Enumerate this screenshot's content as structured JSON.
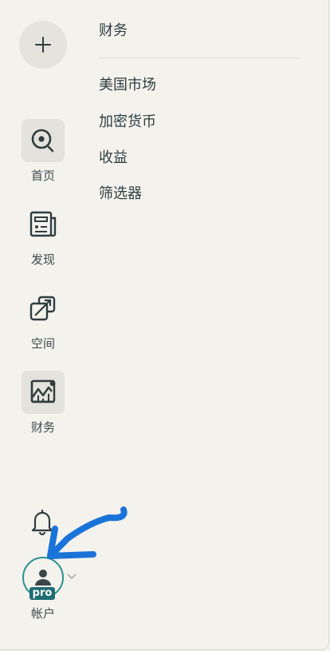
{
  "sidebar": {
    "items": [
      {
        "label": "首页",
        "icon": "search-circle-icon",
        "active": true
      },
      {
        "label": "发现",
        "icon": "newspaper-icon",
        "active": false
      },
      {
        "label": "空间",
        "icon": "spaces-icon",
        "active": false
      },
      {
        "label": "财务",
        "icon": "chart-line-icon",
        "active": true
      }
    ],
    "account": {
      "label": "帐户",
      "badge": "pro"
    }
  },
  "menu": {
    "title": "财务",
    "links": [
      "美国市场",
      "加密货币",
      "收益",
      "筛选器"
    ]
  },
  "colors": {
    "background": "#f3f2ed",
    "text": "#2f3d40",
    "accent": "#2c8f93",
    "badge": "#1f6d73",
    "annotation_arrow": "#1a73d9"
  }
}
